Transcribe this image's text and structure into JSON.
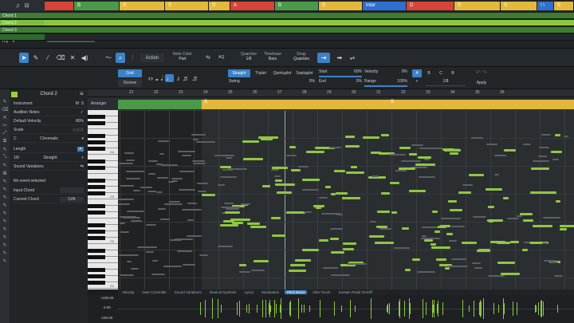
{
  "overview": {
    "segments": [
      {
        "label": "",
        "color": "#d64537"
      },
      {
        "label": "B",
        "color": "#4a9a4a"
      },
      {
        "label": "S",
        "color": "#e4b83a"
      },
      {
        "label": "S",
        "color": "#e4b83a"
      },
      {
        "label": "S'",
        "color": "#e4b83a"
      },
      {
        "label": "A",
        "color": "#d64537"
      },
      {
        "label": "B",
        "color": "#4a9a4a"
      },
      {
        "label": "S",
        "color": "#e4b83a"
      },
      {
        "label": "Inter",
        "color": "#2f6fd0"
      },
      {
        "label": "D",
        "color": "#d64537"
      },
      {
        "label": "S",
        "color": "#e4b83a"
      },
      {
        "label": "S",
        "color": "#e4b83a"
      },
      {
        "label": "\\ \\",
        "color": "#2f6fd0"
      },
      {
        "label": "S",
        "color": "#e4b83a"
      }
    ],
    "tracks": [
      {
        "name": "Chord 1",
        "color": "#3f7d35"
      },
      {
        "name": "Chord 2",
        "color": "#7fbf3f"
      },
      {
        "name": "Chord 3",
        "color": "#3f7d35"
      },
      {
        "name": "",
        "color": "#2e6a2e"
      }
    ],
    "bottom_label": "Thy"
  },
  "toolbar": {
    "action_label": "Action",
    "note_color_label": "Note Color",
    "note_color_value": "Part",
    "aq_label": "AQ",
    "quantize_label": "Quantize",
    "quantize_value": "1/8",
    "timebase_label": "Timebase",
    "timebase_value": "Bars",
    "snap_label": "Snap",
    "snap_value": "Quantize"
  },
  "quantize_panel": {
    "grid": "Grid",
    "groove": "Groove",
    "straight": "Straight",
    "triplet": "Triplet",
    "quintuplet": "Quintuplet",
    "septuplet": "Septuplet",
    "swing": "Swing",
    "swing_val": "0%",
    "start": "Start",
    "start_val": "60%",
    "end": "End",
    "end_val": "0%",
    "velocity": "Velocity",
    "velocity_val": "0%",
    "range": "Range",
    "range_val": "100%",
    "presets": [
      "A",
      "B",
      "C",
      "B"
    ],
    "preset_sub": "1/8",
    "apply": "Apply"
  },
  "inspector": {
    "track_name": "Chord 2",
    "instrument": "Instrument",
    "audition": "Audition Notes",
    "default_velocity": "Default Velocity",
    "default_velocity_val": "80%",
    "scale": "Scale",
    "scale_root": "C",
    "scale_type": "Chromatic",
    "length": "Length",
    "length_val": "1/8",
    "length_mode": "Straight",
    "sound_variations": "Sound Variations",
    "no_event": "No event selected",
    "input_chord": "Input Chord",
    "current_chord": "Current Chord",
    "current_chord_val": "C#6"
  },
  "editor": {
    "arranger_label": "Arranger",
    "bars": [
      "21",
      "22",
      "23",
      "24",
      "25",
      "26",
      "27",
      "28",
      "29",
      "30",
      "31",
      "32",
      "33",
      "34",
      "35",
      "36"
    ],
    "arranger_parts": [
      "S",
      "S"
    ],
    "octaves": [
      "C4",
      "C3",
      "C2",
      "C1"
    ]
  },
  "lanes": {
    "tabs": [
      "Velocity",
      "Note Controller",
      "Sound Variations",
      "Musical Symbols",
      "Lyrics",
      "Modulation",
      "Pitch Bend",
      "After Touch",
      "Sustain Pedal On/Off"
    ],
    "active": "Pitch Bend",
    "scale": [
      "+100.00",
      "0.00",
      "-100.00"
    ]
  },
  "colors": {
    "accent": "#3b82c6",
    "note": "#8fc742",
    "arranger_s": "#e4b83a"
  }
}
